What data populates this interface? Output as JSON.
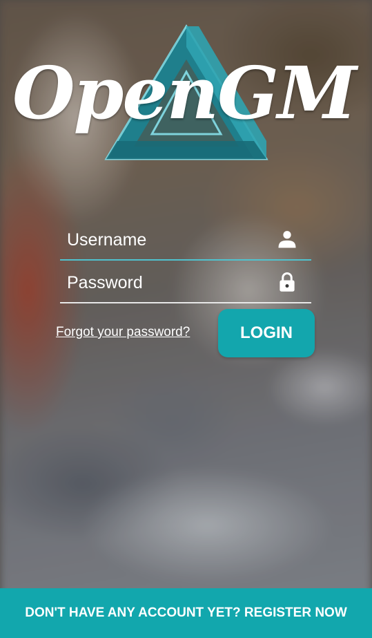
{
  "logo": {
    "text": "OpenGM",
    "icon": "penrose-triangle-icon",
    "triangle_color": "#2a8a96"
  },
  "form": {
    "username": {
      "placeholder": "Username",
      "value": "",
      "icon": "user-icon"
    },
    "password": {
      "placeholder": "Password",
      "value": "",
      "icon": "lock-icon"
    },
    "forgot_link": "Forgot your password?",
    "login_label": "LOGIN"
  },
  "footer": {
    "register_label": "DON'T HAVE ANY ACCOUNT YET? REGISTER NOW"
  },
  "colors": {
    "accent": "#13a6ad",
    "underline_active": "#4fc3cf",
    "text": "#ffffff"
  }
}
